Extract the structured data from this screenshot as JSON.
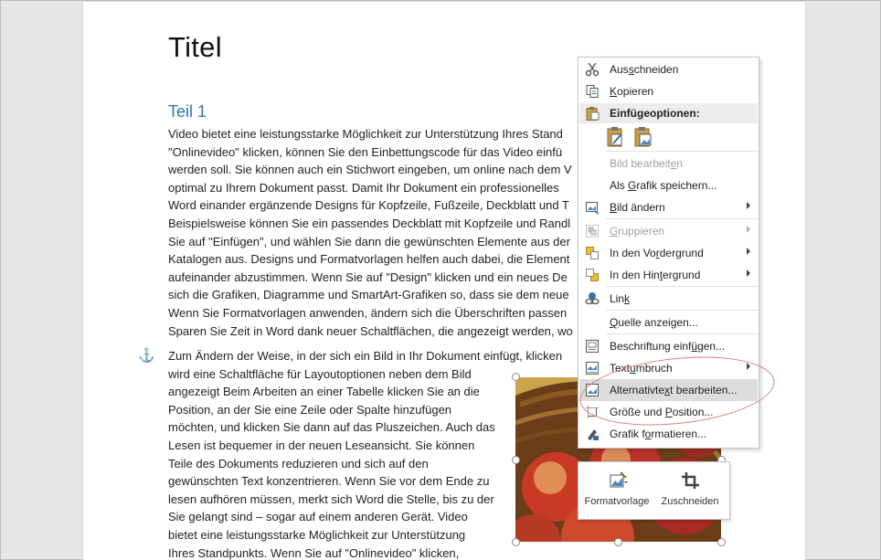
{
  "document": {
    "title": "Titel",
    "heading": "Teil 1",
    "paragraph1": [
      "Video bietet eine leistungsstarke Möglichkeit zur Unterstützung Ihres Stand",
      "\"Onlinevideo\" klicken, können Sie den Einbettungscode für das Video einfü",
      "werden soll. Sie können auch ein Stichwort eingeben, um online nach dem V",
      "optimal zu Ihrem Dokument passt. Damit Ihr Dokument ein professionelles",
      "Word einander ergänzende Designs für Kopfzeile, Fußzeile, Deckblatt und T",
      "Beispielsweise können Sie ein passendes Deckblatt mit Kopfzeile und Randl",
      "Sie auf \"Einfügen\", und wählen Sie dann die gewünschten Elemente aus der",
      "Katalogen aus. Designs und Formatvorlagen helfen auch dabei, die Element",
      "aufeinander abzustimmen. Wenn Sie auf \"Design\" klicken und ein neues De",
      "sich die Grafiken, Diagramme und SmartArt-Grafiken so, dass sie dem neue",
      "Wenn Sie Formatvorlagen anwenden, ändern sich die Überschriften passen",
      "Sparen Sie Zeit in Word dank neuer Schaltflächen, die angezeigt werden, wo"
    ],
    "paragraph2": [
      "Zum Ändern der Weise, in der sich ein Bild in Ihr Dokument einfügt, klicken",
      "wird eine Schaltfläche für Layoutoptionen neben dem Bild",
      "angezeigt Beim Arbeiten an einer Tabelle klicken Sie an die",
      "Position, an der Sie eine Zeile oder Spalte hinzufügen",
      "möchten, und klicken Sie dann auf das Pluszeichen. Auch das",
      "Lesen ist bequemer in der neuen Leseansicht. Sie können",
      "Teile des Dokuments reduzieren und sich auf den",
      "gewünschten Text konzentrieren. Wenn Sie vor dem Ende zu",
      "lesen aufhören müssen, merkt sich Word die Stelle, bis zu der",
      "Sie gelangt sind – sogar auf einem anderen Gerät. Video",
      "bietet eine leistungsstarke Möglichkeit zur Unterstützung",
      "Ihres Standpunkts. Wenn Sie auf \"Onlinevideo\" klicken,"
    ]
  },
  "context_menu": {
    "cut": "Ausschneiden",
    "copy": "Kopieren",
    "paste_options": "Einfügeoptionen:",
    "edit_picture": "Bild bearbeiten",
    "save_as_picture": "Als Grafik speichern...",
    "change_picture": "Bild ändern",
    "group": "Gruppieren",
    "bring_forward": "In den Vordergrund",
    "send_backward": "In den Hintergrund",
    "link": "Link",
    "show_source": "Quelle anzeigen...",
    "insert_caption": "Beschriftung einfügen...",
    "wrap_text": "Textumbruch",
    "edit_alt_text": "Alternativtext bearbeiten...",
    "size_position": "Größe und Position...",
    "format_picture": "Grafik formatieren..."
  },
  "mini_toolbar": {
    "style": "Formatvorlage",
    "crop": "Zuschneiden"
  },
  "colors": {
    "heading": "#2e74b5",
    "highlight": "#dcdcdc",
    "annotation_oval": "#d9807a"
  }
}
